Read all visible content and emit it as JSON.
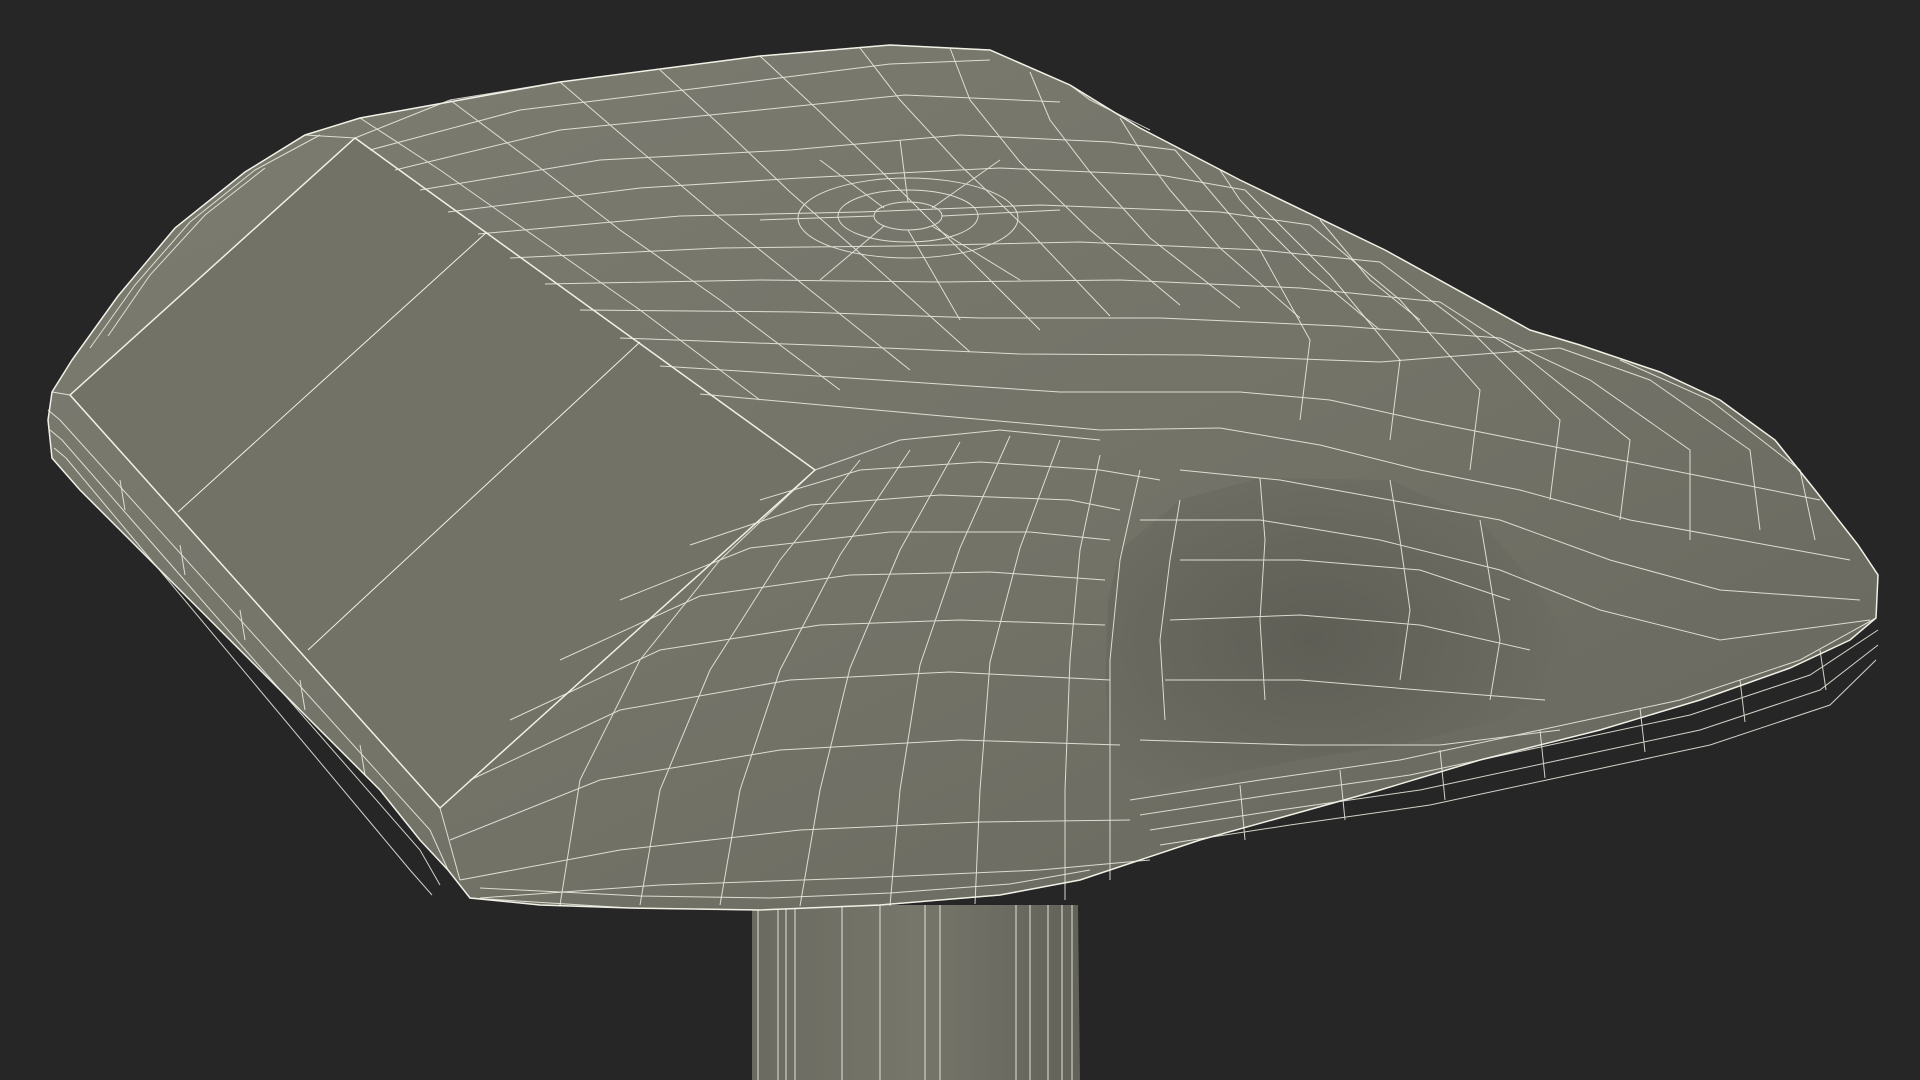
{
  "scene": {
    "background_color": "#262626",
    "surface_color": "#737368",
    "surface_shadow_color": "#62625a",
    "wire_color": "#f0f0e6",
    "render_mode": "wireframe-on-shaded"
  }
}
